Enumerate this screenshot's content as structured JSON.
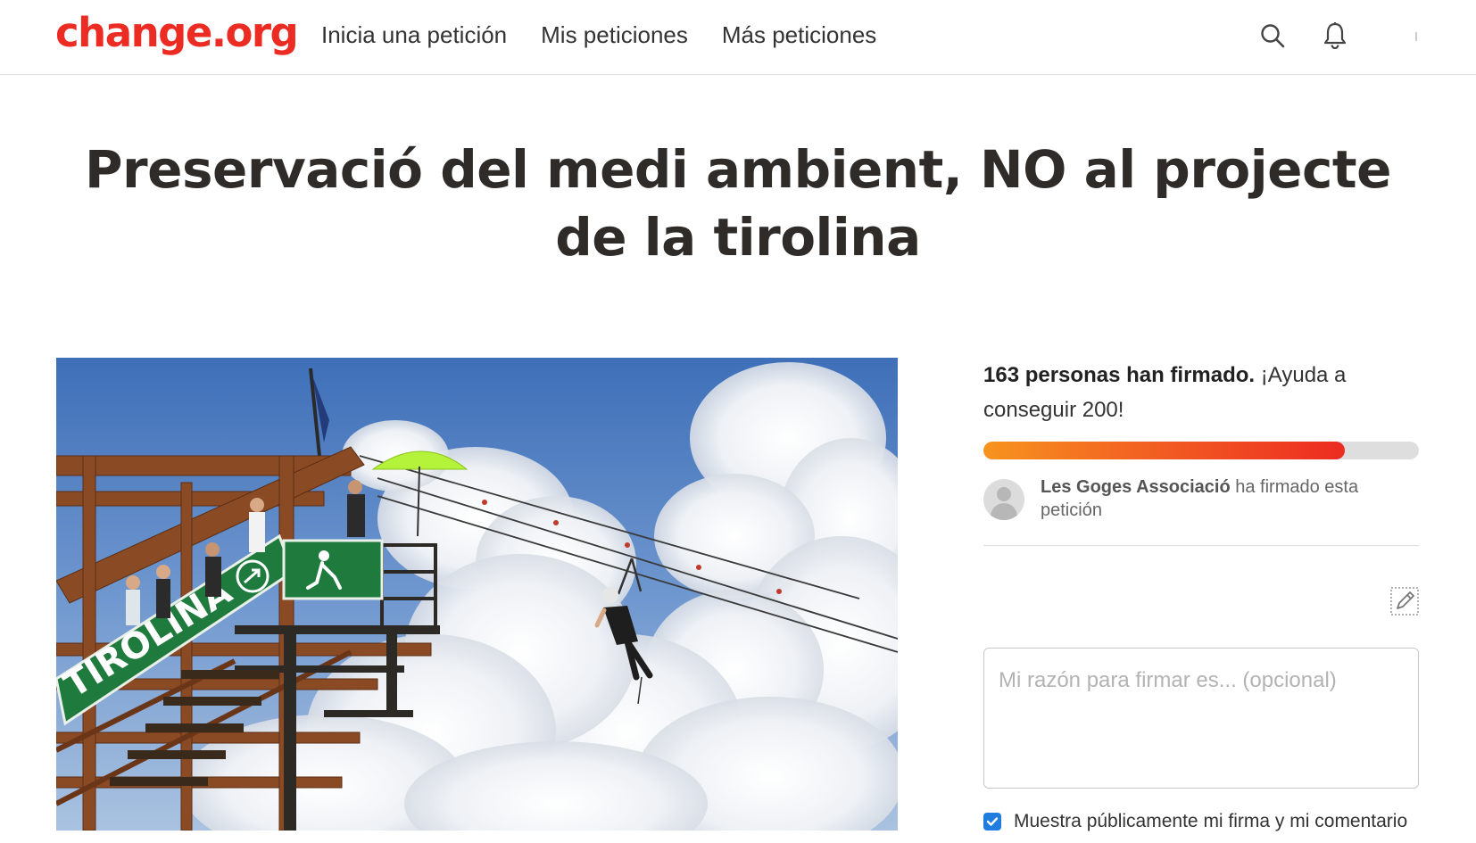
{
  "header": {
    "logo": "change.org",
    "nav": [
      {
        "label": "Inicia una petición"
      },
      {
        "label": "Mis peticiones"
      },
      {
        "label": "Más peticiones"
      }
    ],
    "icons": [
      "search-icon",
      "bell-icon"
    ]
  },
  "petition": {
    "title": "Preservació del medi ambient, NO al projecte de la tirolina",
    "image": {
      "sign_text": "TIROLINA"
    }
  },
  "sidebar": {
    "signatures_bold": "163 personas han firmado.",
    "signatures_rest": " ¡Ayuda a conseguir 200!",
    "progress": 0.83,
    "recent_signer_name": "Les Goges Associació",
    "recent_signer_text": " ha firmado esta petición",
    "reason_placeholder": "Mi razón para firmar es... (opcional)",
    "public_checkbox_checked": true,
    "public_checkbox_label": "Muestra públicamente mi firma y mi comentario"
  },
  "colors": {
    "brand": "#ec2c22",
    "progress_start": "#f7941e",
    "progress_end": "#ec2c22",
    "checkbox": "#1f7de0"
  }
}
